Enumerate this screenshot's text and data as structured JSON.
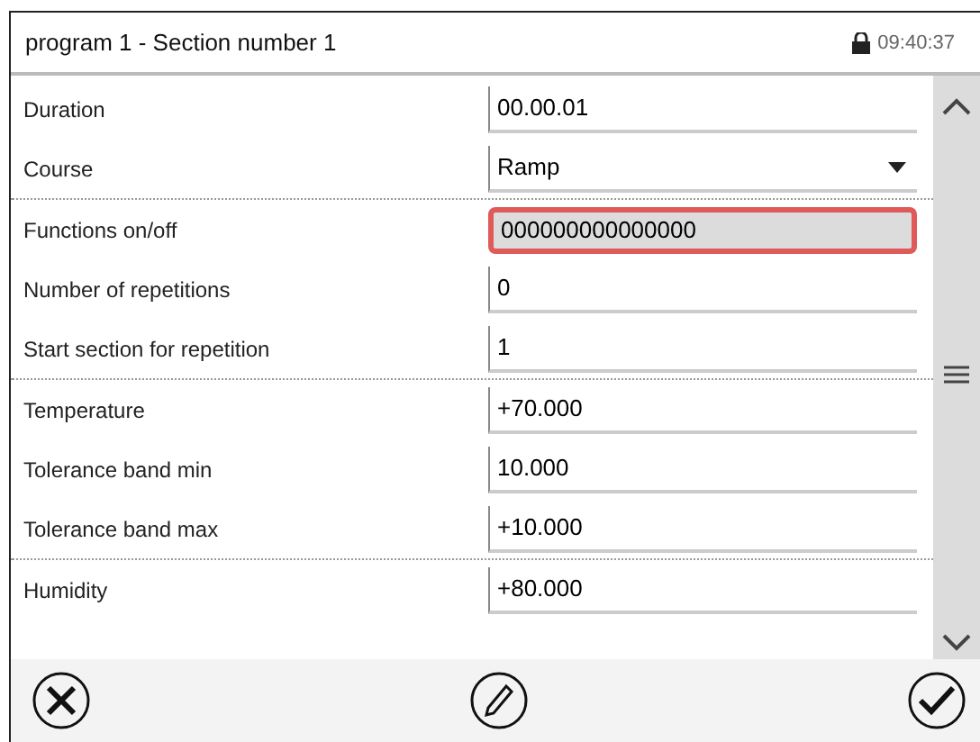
{
  "header": {
    "title": "program 1 - Section number 1",
    "time": "09:40:37"
  },
  "groups": [
    {
      "rows": [
        {
          "label": "Duration",
          "value": "00.00.01",
          "kind": "text",
          "selected": false
        },
        {
          "label": "Course",
          "value": "Ramp",
          "kind": "select",
          "selected": false
        }
      ]
    },
    {
      "rows": [
        {
          "label": "Functions on/off",
          "value": "000000000000000",
          "kind": "text",
          "selected": true
        },
        {
          "label": "Number of repetitions",
          "value": "0",
          "kind": "text",
          "selected": false
        },
        {
          "label": "Start section for repetition",
          "value": "1",
          "kind": "text",
          "selected": false
        }
      ]
    },
    {
      "rows": [
        {
          "label": "Temperature",
          "value": "+70.000",
          "kind": "text",
          "selected": false
        },
        {
          "label": "Tolerance band min",
          "value": "10.000",
          "kind": "text",
          "selected": false
        },
        {
          "label": "Tolerance band max",
          "value": "+10.000",
          "kind": "text",
          "selected": false
        }
      ]
    },
    {
      "rows": [
        {
          "label": "Humidity",
          "value": "+80.000",
          "kind": "text",
          "selected": false
        }
      ]
    }
  ]
}
